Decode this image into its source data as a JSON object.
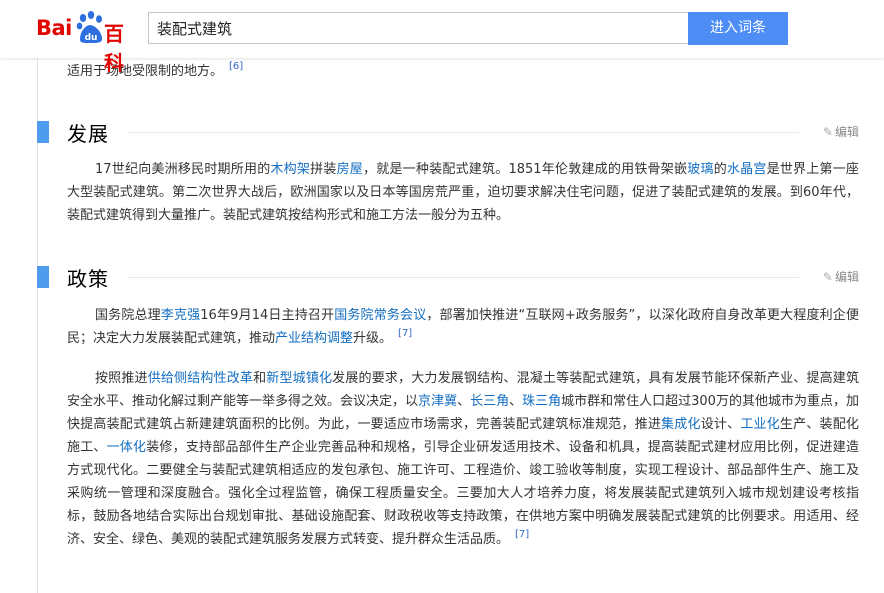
{
  "header": {
    "logo_bai": "Bai",
    "logo_du": "du",
    "logo_ke": "百科",
    "search_value": "装配式建筑",
    "search_button": "进入词条",
    "brand_red": "#e10602",
    "brand_blue": "#2e6fe0",
    "button_color": "#4e8df5"
  },
  "top_fragment": {
    "text": "适用于场地受限制的地方。",
    "ref": "[6]"
  },
  "sections": [
    {
      "title": "发展",
      "edit_label": "编辑",
      "paragraphs": [
        {
          "parts": [
            {
              "t": "17世纪向美洲移民时期所用的"
            },
            {
              "t": "木构架",
              "link": true
            },
            {
              "t": "拼装"
            },
            {
              "t": "房屋",
              "link": true
            },
            {
              "t": "，就是一种装配式建筑。1851年伦敦建成的用铁骨架嵌"
            },
            {
              "t": "玻璃",
              "link": true
            },
            {
              "t": "的"
            },
            {
              "t": "水晶宫",
              "link": true
            },
            {
              "t": "是世界上第一座大型装配式建筑。第二次世界大战后，欧洲国家以及日本等国房荒严重，迫切要求解决住宅问题，促进了装配式建筑的发展。到60年代，装配式建筑得到大量推广。装配式建筑按结构形式和施工方法一般分为五种。"
            }
          ]
        }
      ]
    },
    {
      "title": "政策",
      "edit_label": "编辑",
      "paragraphs": [
        {
          "parts": [
            {
              "t": "国务院总理"
            },
            {
              "t": "李克强",
              "link": true
            },
            {
              "t": "16年9月14日主持召开"
            },
            {
              "t": "国务院常务会议",
              "link": true
            },
            {
              "t": "，部署加快推进“互联网+政务服务”，以深化政府自身改革更大程度利企便民；决定大力发展装配式建筑，推动"
            },
            {
              "t": "产业结构调整",
              "link": true
            },
            {
              "t": "升级。"
            }
          ],
          "ref": "[7]"
        },
        {
          "parts": [
            {
              "t": "按照推进"
            },
            {
              "t": "供给侧结构性改革",
              "link": true
            },
            {
              "t": "和"
            },
            {
              "t": "新型城镇化",
              "link": true
            },
            {
              "t": "发展的要求，大力发展钢结构、混凝土等装配式建筑，具有发展节能环保新产业、提高建筑安全水平、推动化解过剩产能等一举多得之效。会议决定，以"
            },
            {
              "t": "京津冀",
              "link": true
            },
            {
              "t": "、"
            },
            {
              "t": "长三角",
              "link": true
            },
            {
              "t": "、"
            },
            {
              "t": "珠三角",
              "link": true
            },
            {
              "t": "城市群和常住人口超过300万的其他城市为重点，加快提高装配式建筑占新建建筑面积的比例。为此，一要适应市场需求，完善装配式建筑标准规范，推进"
            },
            {
              "t": "集成化",
              "link": true
            },
            {
              "t": "设计、"
            },
            {
              "t": "工业化",
              "link": true
            },
            {
              "t": "生产、装配化施工、"
            },
            {
              "t": "一体化",
              "link": true
            },
            {
              "t": "装修，支持部品部件生产企业完善品种和规格，引导企业研发适用技术、设备和机具，提高装配式建材应用比例，促进建造方式现代化。二要健全与装配式建筑相适应的发包承包、施工许可、工程造价、竣工验收等制度，实现工程设计、部品部件生产、施工及采购统一管理和深度融合。强化全过程监管，确保工程质量安全。三要加大人才培养力度，将发展装配式建筑列入城市规划建设考核指标，鼓励各地结合实际出台规划审批、基础设施配套、财政税收等支持政策，在供地方案中明确发展装配式建筑的比例要求。用适用、经济、安全、绿色、美观的装配式建筑服务发展方式转变、提升群众生活品质。"
            }
          ],
          "ref": "[7]"
        }
      ]
    }
  ]
}
